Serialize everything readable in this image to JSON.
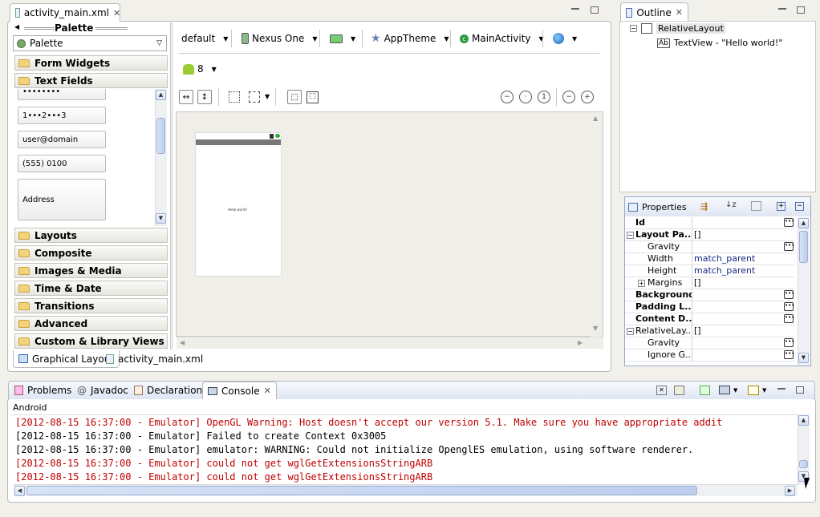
{
  "editor": {
    "tab_title": "activity_main.xml",
    "bottom_tabs": [
      "Graphical Layout",
      "activity_main.xml"
    ]
  },
  "palette": {
    "header": "Palette",
    "selector": "Palette",
    "categories_top": [
      "Form Widgets",
      "Text Fields"
    ],
    "widgets": [
      "••••••••",
      "1•••2•••3",
      "user@domain",
      "(555) 0100",
      "Address"
    ],
    "categories_bottom": [
      "Layouts",
      "Composite",
      "Images & Media",
      "Time & Date",
      "Transitions",
      "Advanced",
      "Custom & Library Views"
    ]
  },
  "toolbar": {
    "config": "default",
    "device": "Nexus One",
    "theme": "AppTheme",
    "activity": "MainActivity",
    "api": "8"
  },
  "canvas": {
    "hello_text": "Hello world!"
  },
  "outline": {
    "title": "Outline",
    "root": "RelativeLayout",
    "child": "TextView - \"Hello world!\""
  },
  "properties": {
    "title": "Properties",
    "rows": [
      {
        "name": "Id",
        "value": "",
        "bold": true,
        "edit": true
      },
      {
        "name": "Layout Pa...",
        "value": "[]",
        "bold": true,
        "expander": "−"
      },
      {
        "name": "Gravity",
        "value": "",
        "indent": true,
        "edit": true
      },
      {
        "name": "Width",
        "value": "match_parent",
        "indent": true
      },
      {
        "name": "Height",
        "value": "match_parent",
        "indent": true
      },
      {
        "name": "Margins",
        "value": "[]",
        "indent": true,
        "expander": "+"
      },
      {
        "name": "Background",
        "value": "",
        "bold": true,
        "edit": true
      },
      {
        "name": "Padding L...",
        "value": "",
        "bold": true,
        "edit": true
      },
      {
        "name": "Content D...",
        "value": "",
        "bold": true,
        "edit": true
      },
      {
        "name": "RelativeLay...",
        "value": "[]",
        "expander": "−"
      },
      {
        "name": "Gravity",
        "value": "",
        "indent": true,
        "edit": true
      },
      {
        "name": "Ignore G...",
        "value": "",
        "indent": true,
        "edit": true
      }
    ]
  },
  "bottom_panel": {
    "tabs": [
      "Problems",
      "Javadoc",
      "Declaration",
      "Console"
    ],
    "console_name": "Android",
    "lines": [
      {
        "text": "[2012-08-15 16:37:00 - Emulator] OpenGL Warning: Host doesn't accept our version 5.1. Make sure you have appropriate addit",
        "error": true
      },
      {
        "text": "[2012-08-15 16:37:00 - Emulator] Failed to create Context 0x3005",
        "error": false
      },
      {
        "text": "[2012-08-15 16:37:00 - Emulator] emulator: WARNING: Could not initialize OpenglES emulation, using software renderer.",
        "error": false
      },
      {
        "text": "[2012-08-15 16:37:00 - Emulator] could not get wglGetExtensionsStringARB",
        "error": true
      },
      {
        "text": "[2012-08-15 16:37:00 - Emulator] could not get wglGetExtensionsStringARB",
        "error": true
      }
    ]
  },
  "colors": {
    "error": "#c00000",
    "normal": "#000000"
  }
}
